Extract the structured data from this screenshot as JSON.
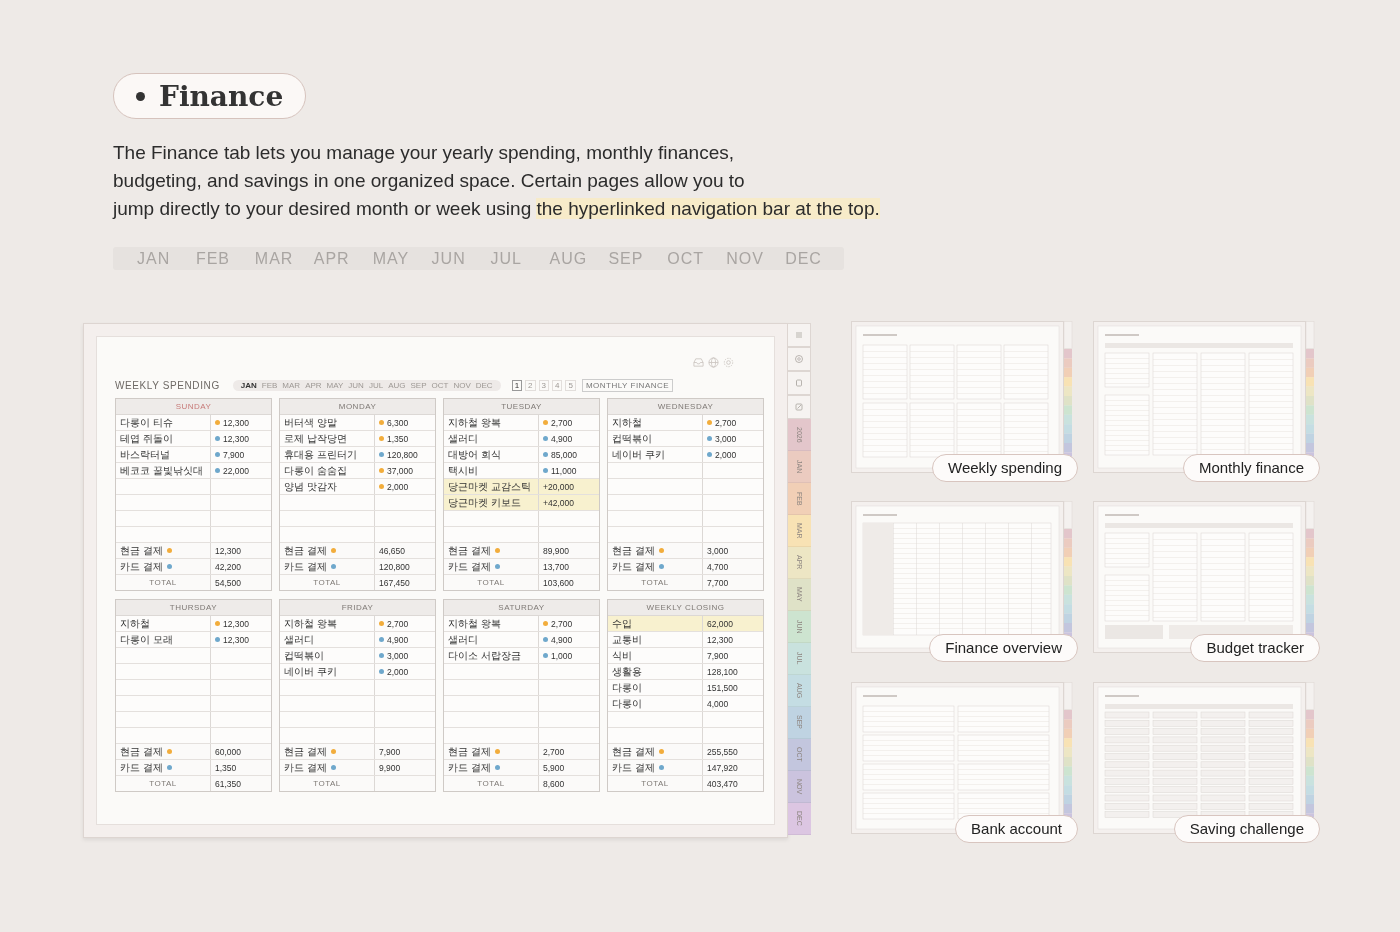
{
  "heading": "Finance",
  "description_lines": [
    [
      {
        "text": "The Finance tab lets you manage your yearly spending, monthly finances,",
        "highlighted": false
      }
    ],
    [
      {
        "text": "budgeting, and savings in one organized space. Certain pages allow you to",
        "highlighted": false
      }
    ],
    [
      {
        "text": "jump directly to your desired month or week using ",
        "highlighted": false
      },
      {
        "text": "the hyperlinked navigation bar at the top.",
        "highlighted": true
      }
    ]
  ],
  "month_bar": [
    "JAN",
    "FEB",
    "MAR",
    "APR",
    "MAY",
    "JUN",
    "JUL",
    "AUG",
    "SEP",
    "OCT",
    "NOV",
    "DEC"
  ],
  "planner": {
    "title": "WEEKLY SPENDING",
    "months": [
      {
        "label": "JAN",
        "selected": true
      },
      {
        "label": "FEB",
        "selected": false
      },
      {
        "label": "MAR",
        "selected": false
      },
      {
        "label": "APR",
        "selected": false
      },
      {
        "label": "MAY",
        "selected": false
      },
      {
        "label": "JUN",
        "selected": false
      },
      {
        "label": "JUL",
        "selected": false
      },
      {
        "label": "AUG",
        "selected": false
      },
      {
        "label": "SEP",
        "selected": false
      },
      {
        "label": "OCT",
        "selected": false
      },
      {
        "label": "NOV",
        "selected": false
      },
      {
        "label": "DEC",
        "selected": false
      }
    ],
    "weeks": [
      {
        "label": "1",
        "selected": true
      },
      {
        "label": "2",
        "selected": false
      },
      {
        "label": "3",
        "selected": false
      },
      {
        "label": "4",
        "selected": false
      },
      {
        "label": "5",
        "selected": false
      }
    ],
    "link": "MONTHLY FINANCE",
    "days": [
      {
        "header": "SUNDAY",
        "highlighted": true,
        "entries": [
          {
            "name": "다롱이 티슈",
            "kind": "cash",
            "amount": "12,300",
            "highlighted": false
          },
          {
            "name": "테엽 쥐돌이",
            "kind": "card",
            "amount": "12,300",
            "highlighted": false
          },
          {
            "name": "바스락터널",
            "kind": "card",
            "amount": "7,900",
            "highlighted": false
          },
          {
            "name": "베코코 꿀빛낚싯대",
            "kind": "card",
            "amount": "22,000",
            "highlighted": false
          }
        ],
        "summary": [
          {
            "kind": "cash",
            "label": "현금 결제",
            "amount": "12,300"
          },
          {
            "kind": "card",
            "label": "카드 결제",
            "amount": "42,200"
          },
          {
            "kind": "total",
            "label": "TOTAL",
            "amount": "54,500"
          }
        ]
      },
      {
        "header": "MONDAY",
        "highlighted": false,
        "entries": [
          {
            "name": "버터색 양말",
            "kind": "cash",
            "amount": "6,300",
            "highlighted": false
          },
          {
            "name": "로제 납작당면",
            "kind": "cash",
            "amount": "1,350",
            "highlighted": false
          },
          {
            "name": "휴대용 프린터기",
            "kind": "card",
            "amount": "120,800",
            "highlighted": false
          },
          {
            "name": "다롱이 숨숨집",
            "kind": "cash",
            "amount": "37,000",
            "highlighted": false
          },
          {
            "name": "양념 맛감자",
            "kind": "cash",
            "amount": "2,000",
            "highlighted": false
          }
        ],
        "summary": [
          {
            "kind": "cash",
            "label": "현금 결제",
            "amount": "46,650"
          },
          {
            "kind": "card",
            "label": "카드 결제",
            "amount": "120,800"
          },
          {
            "kind": "total",
            "label": "TOTAL",
            "amount": "167,450"
          }
        ]
      },
      {
        "header": "TUESDAY",
        "highlighted": false,
        "entries": [
          {
            "name": "지하철 왕복",
            "kind": "cash",
            "amount": "2,700",
            "highlighted": false
          },
          {
            "name": "샐러디",
            "kind": "card",
            "amount": "4,900",
            "highlighted": false
          },
          {
            "name": "대방어 회식",
            "kind": "card",
            "amount": "85,000",
            "highlighted": false
          },
          {
            "name": "택시비",
            "kind": "card",
            "amount": "11,000",
            "highlighted": false
          },
          {
            "name": "당근마켓 교감스틱",
            "amount": "+20,000",
            "highlighted": true
          },
          {
            "name": "당근마켓 키보드",
            "amount": "+42,000",
            "highlighted": true
          }
        ],
        "summary": [
          {
            "kind": "cash",
            "label": "현금 결제",
            "amount": "89,900"
          },
          {
            "kind": "card",
            "label": "카드 결제",
            "amount": "13,700"
          },
          {
            "kind": "total",
            "label": "TOTAL",
            "amount": "103,600"
          }
        ]
      },
      {
        "header": "WEDNESDAY",
        "highlighted": false,
        "entries": [
          {
            "name": "지하철",
            "kind": "cash",
            "amount": "2,700",
            "highlighted": false
          },
          {
            "name": "컵떡볶이",
            "kind": "card",
            "amount": "3,000",
            "highlighted": false
          },
          {
            "name": "네이버 쿠키",
            "kind": "card",
            "amount": "2,000",
            "highlighted": false
          }
        ],
        "summary": [
          {
            "kind": "cash",
            "label": "현금 결제",
            "amount": "3,000"
          },
          {
            "kind": "card",
            "label": "카드 결제",
            "amount": "4,700"
          },
          {
            "kind": "total",
            "label": "TOTAL",
            "amount": "7,700"
          }
        ]
      },
      {
        "header": "THURSDAY",
        "highlighted": false,
        "entries": [
          {
            "name": "지하철",
            "kind": "cash",
            "amount": "12,300",
            "highlighted": false
          },
          {
            "name": "다롱이 모래",
            "kind": "card",
            "amount": "12,300",
            "highlighted": false
          }
        ],
        "summary": [
          {
            "kind": "cash",
            "label": "현금 결제",
            "amount": "60,000"
          },
          {
            "kind": "card",
            "label": "카드 결제",
            "amount": "1,350"
          },
          {
            "kind": "total",
            "label": "TOTAL",
            "amount": "61,350"
          }
        ]
      },
      {
        "header": "FRIDAY",
        "highlighted": false,
        "entries": [
          {
            "name": "지하철 왕복",
            "kind": "cash",
            "amount": "2,700",
            "highlighted": false
          },
          {
            "name": "샐러디",
            "kind": "card",
            "amount": "4,900",
            "highlighted": false
          },
          {
            "name": "컵떡볶이",
            "kind": "card",
            "amount": "3,000",
            "highlighted": false
          },
          {
            "name": "네이버 쿠키",
            "kind": "card",
            "amount": "2,000",
            "highlighted": false
          }
        ],
        "summary": [
          {
            "kind": "cash",
            "label": "현금 결제",
            "amount": "7,900"
          },
          {
            "kind": "card",
            "label": "카드 결제",
            "amount": "9,900"
          },
          {
            "kind": "total",
            "label": "TOTAL"
          }
        ]
      },
      {
        "header": "SATURDAY",
        "highlighted": false,
        "entries": [
          {
            "name": "지하철 왕복",
            "kind": "cash",
            "amount": "2,700",
            "highlighted": false
          },
          {
            "name": "샐러디",
            "kind": "card",
            "amount": "4,900",
            "highlighted": false
          },
          {
            "name": "다이소 서랍장금",
            "kind": "card",
            "amount": "1,000",
            "highlighted": false
          }
        ],
        "summary": [
          {
            "kind": "cash",
            "label": "현금 결제",
            "amount": "2,700"
          },
          {
            "kind": "card",
            "label": "카드 결제",
            "amount": "5,900"
          },
          {
            "kind": "total",
            "label": "TOTAL",
            "amount": "8,600"
          }
        ]
      },
      {
        "header": "WEEKLY CLOSING",
        "highlighted": false,
        "entries": [
          {
            "name": "수입",
            "amount": "62,000",
            "highlighted": true
          },
          {
            "name": "교통비",
            "amount": "12,300",
            "highlighted": false
          },
          {
            "name": "식비",
            "amount": "7,900",
            "highlighted": false
          },
          {
            "name": "생활용",
            "amount": "128,100",
            "highlighted": false
          },
          {
            "name": "다롱이",
            "amount": "151,500",
            "highlighted": false
          },
          {
            "name": "다롱이",
            "amount": "4,000",
            "highlighted": false
          }
        ],
        "summary": [
          {
            "kind": "cash",
            "label": "현금 결제",
            "amount": "255,550"
          },
          {
            "kind": "card",
            "label": "카드 결제",
            "amount": "147,920"
          },
          {
            "kind": "total",
            "label": "TOTAL",
            "amount": "403,470"
          }
        ]
      }
    ],
    "side_tabs": [
      {
        "label": "2026",
        "color": "#e3c6cb"
      },
      {
        "label": "JAN",
        "color": "#ebcbc0"
      },
      {
        "label": "FEB",
        "color": "#f1cfb6"
      },
      {
        "label": "MAR",
        "color": "#f8e2b4"
      },
      {
        "label": "APR",
        "color": "#ede6c4"
      },
      {
        "label": "MAY",
        "color": "#dfe2c7"
      },
      {
        "label": "JUN",
        "color": "#cde4d0"
      },
      {
        "label": "JUL",
        "color": "#c9e2de"
      },
      {
        "label": "AUG",
        "color": "#c4dde3"
      },
      {
        "label": "SEP",
        "color": "#bfd3e2"
      },
      {
        "label": "OCT",
        "color": "#c3c6de"
      },
      {
        "label": "NOV",
        "color": "#cbc3de"
      },
      {
        "label": "DEC",
        "color": "#dcc6e2"
      }
    ]
  },
  "previews": [
    {
      "kind": "weekly",
      "label": "Weekly spending"
    },
    {
      "kind": "monthly",
      "label": "Monthly finance"
    },
    {
      "kind": "overview",
      "label": "Finance overview"
    },
    {
      "kind": "budget",
      "label": "Budget tracker"
    },
    {
      "kind": "bank",
      "label": "Bank account"
    },
    {
      "kind": "savings",
      "label": "Saving challenge"
    }
  ]
}
